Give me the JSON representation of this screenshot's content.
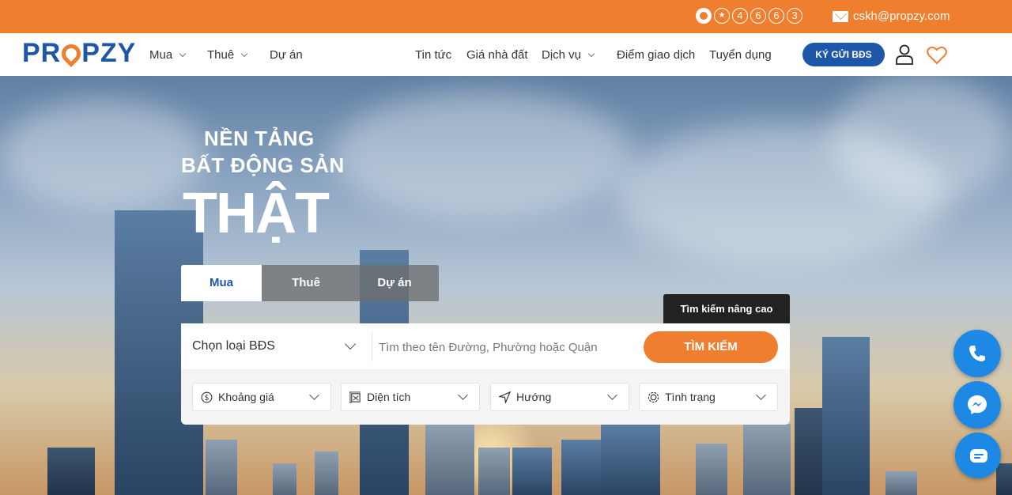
{
  "topbar": {
    "hotline_digits": [
      "★",
      "4",
      "6",
      "6",
      "3"
    ],
    "email": "cskh@propzy.com"
  },
  "nav": {
    "logo_left": "PR",
    "logo_right": "PZY",
    "left_items": [
      {
        "label": "Mua"
      },
      {
        "label": "Thuê"
      },
      {
        "label": "Dự án"
      }
    ],
    "right_items": [
      {
        "label": "Tin tức"
      },
      {
        "label": "Giá nhà đất"
      },
      {
        "label": "Dịch vụ"
      },
      {
        "label": "Điểm giao dịch"
      },
      {
        "label": "Tuyển dụng"
      }
    ],
    "cta_label": "KÝ GỬI BĐS"
  },
  "hero": {
    "line1": "NỀN TẢNG",
    "line2": "BẤT ĐỘNG SẢN",
    "line3": "THẬT"
  },
  "search": {
    "tabs": [
      "Mua",
      "Thuê",
      "Dự án"
    ],
    "active_tab": "Mua",
    "advanced_label": "Tìm kiếm nâng cao",
    "type_select": "Chọn loại BĐS",
    "placeholder": "Tìm theo tên Đường, Phường hoặc Quận",
    "button_label": "TÌM KIẾM",
    "filters": [
      "Khoảng giá",
      "Diện tích",
      "Hướng",
      "Tình trạng"
    ]
  },
  "colors": {
    "accent_orange": "#f07e2f",
    "brand_blue": "#1f57a8",
    "fab_blue": "#1e88e5"
  },
  "icons": [
    "whatsapp-icon",
    "mail-icon",
    "user-icon",
    "heart-icon",
    "money-icon",
    "area-icon",
    "direction-icon",
    "status-icon",
    "phone-icon",
    "messenger-icon",
    "chat-icon"
  ]
}
